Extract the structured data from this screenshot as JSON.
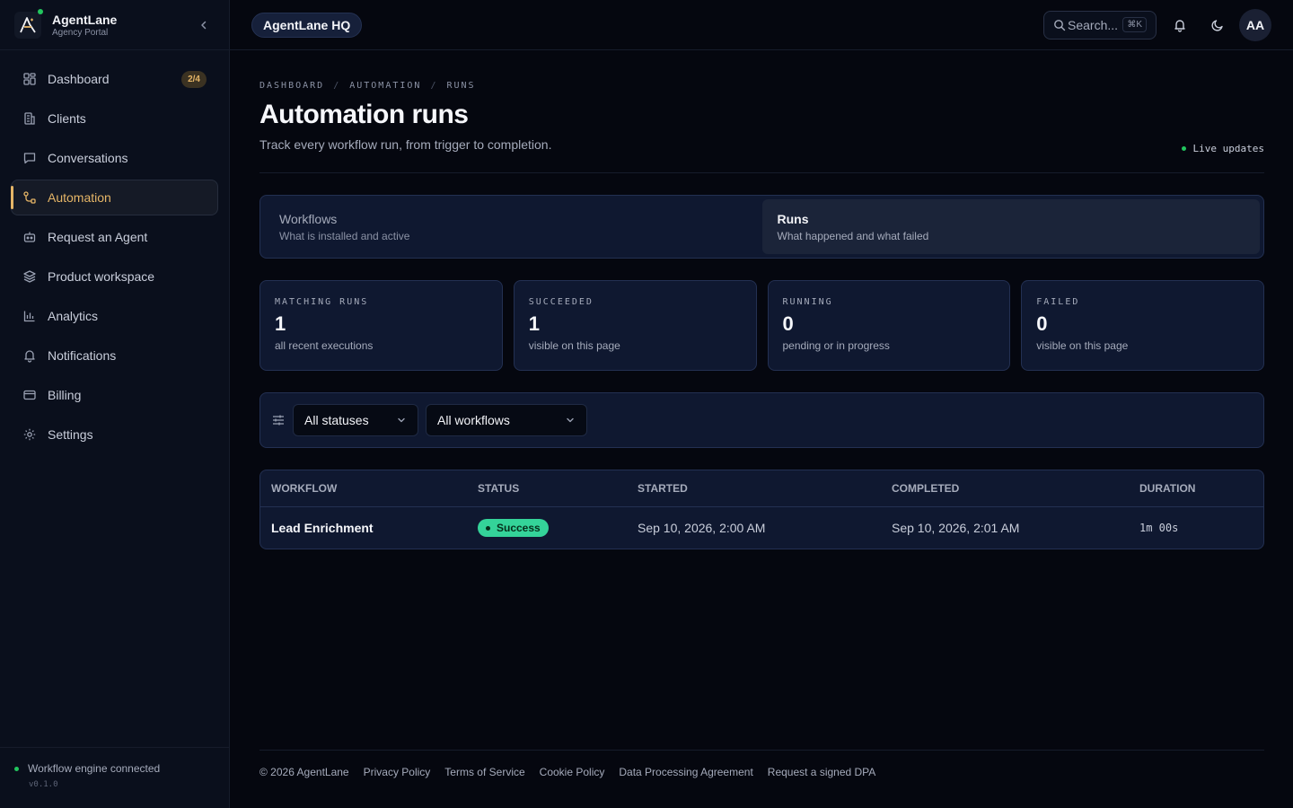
{
  "brand": {
    "name": "AgentLane",
    "subtitle": "Agency Portal"
  },
  "sidebar": {
    "items": [
      {
        "label": "Dashboard",
        "icon": "dashboard-icon",
        "badge": "2/4"
      },
      {
        "label": "Clients",
        "icon": "building-icon"
      },
      {
        "label": "Conversations",
        "icon": "chat-icon"
      },
      {
        "label": "Automation",
        "icon": "workflow-icon",
        "active": true
      },
      {
        "label": "Request an Agent",
        "icon": "bot-icon"
      },
      {
        "label": "Product workspace",
        "icon": "layers-icon"
      },
      {
        "label": "Analytics",
        "icon": "bar-chart-icon"
      },
      {
        "label": "Notifications",
        "icon": "bell-icon"
      },
      {
        "label": "Billing",
        "icon": "credit-card-icon"
      },
      {
        "label": "Settings",
        "icon": "gear-icon"
      }
    ],
    "footer": {
      "status": "Workflow engine connected",
      "version": "v0.1.0"
    }
  },
  "topbar": {
    "workspace": "AgentLane HQ",
    "search_placeholder": "Search...",
    "search_shortcut": "⌘K",
    "avatar_initials": "AA"
  },
  "page": {
    "breadcrumbs": [
      "DASHBOARD",
      "AUTOMATION",
      "RUNS"
    ],
    "title": "Automation runs",
    "subtitle": "Track every workflow run, from trigger to completion.",
    "live_label": "Live updates"
  },
  "tabs": [
    {
      "title": "Workflows",
      "desc": "What is installed and active",
      "active": false
    },
    {
      "title": "Runs",
      "desc": "What happened and what failed",
      "active": true
    }
  ],
  "stats": [
    {
      "label": "MATCHING RUNS",
      "value": "1",
      "note": "all recent executions"
    },
    {
      "label": "SUCCEEDED",
      "value": "1",
      "note": "visible on this page"
    },
    {
      "label": "RUNNING",
      "value": "0",
      "note": "pending or in progress"
    },
    {
      "label": "FAILED",
      "value": "0",
      "note": "visible on this page"
    }
  ],
  "filters": {
    "status_value": "All statuses",
    "workflow_value": "All workflows"
  },
  "table": {
    "columns": [
      "WORKFLOW",
      "STATUS",
      "STARTED",
      "COMPLETED",
      "DURATION"
    ],
    "rows": [
      {
        "workflow": "Lead Enrichment",
        "status": "Success",
        "started": "Sep 10, 2026, 2:00 AM",
        "completed": "Sep 10, 2026, 2:01 AM",
        "duration": "1m 00s"
      }
    ]
  },
  "footer": {
    "copyright": "© 2026 AgentLane",
    "links": [
      "Privacy Policy",
      "Terms of Service",
      "Cookie Policy",
      "Data Processing Agreement",
      "Request a signed DPA"
    ]
  },
  "colors": {
    "accent": "#e5b567",
    "success": "#34d399",
    "live": "#22c55e"
  }
}
